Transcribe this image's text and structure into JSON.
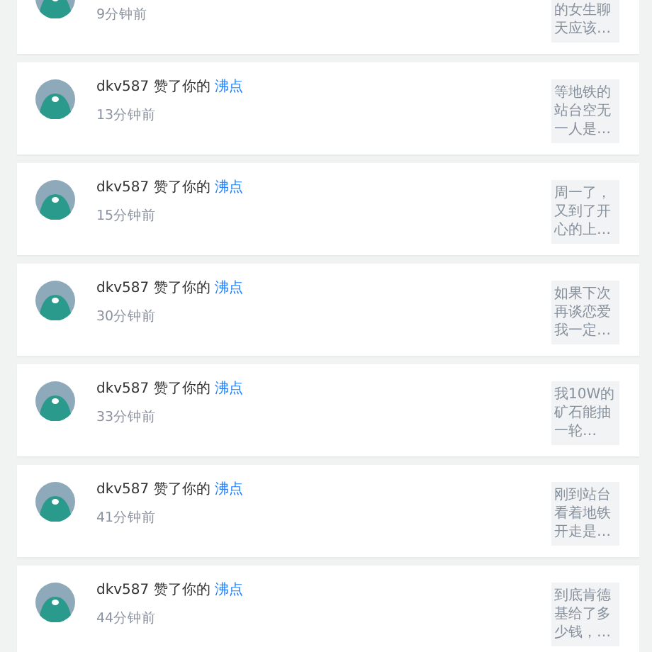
{
  "notifications": [
    {
      "time": "9分钟前",
      "snippet": "的女生聊天应该…"
    },
    {
      "user": "dkv587",
      "action": "赞了你的",
      "target": "沸点",
      "time": "13分钟前",
      "snippet": "等地铁的站台空无一人是…"
    },
    {
      "user": "dkv587",
      "action": "赞了你的",
      "target": "沸点",
      "time": "15分钟前",
      "snippet": "周一了，又到了开心的上…"
    },
    {
      "user": "dkv587",
      "action": "赞了你的",
      "target": "沸点",
      "time": "30分钟前",
      "snippet": "如果下次再谈恋爱我一定…"
    },
    {
      "user": "dkv587",
      "action": "赞了你的",
      "target": "沸点",
      "time": "33分钟前",
      "snippet": "我10W的矿石能抽一轮…"
    },
    {
      "user": "dkv587",
      "action": "赞了你的",
      "target": "沸点",
      "time": "41分钟前",
      "snippet": "刚到站台看着地铁开走是…"
    },
    {
      "user": "dkv587",
      "action": "赞了你的",
      "target": "沸点",
      "time": "44分钟前",
      "snippet": "到底肯德基给了多少钱，…"
    }
  ]
}
